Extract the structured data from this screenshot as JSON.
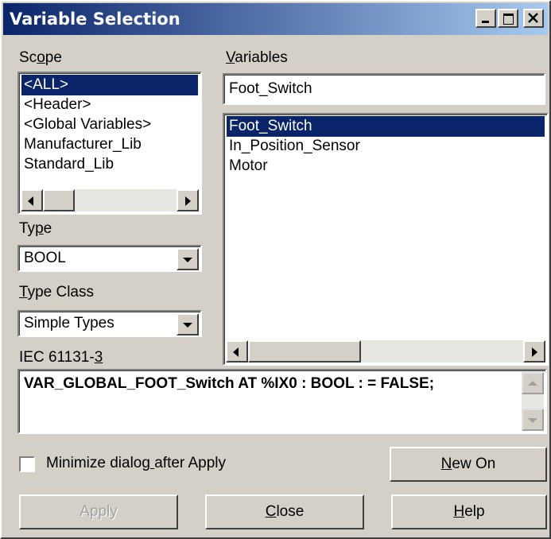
{
  "window": {
    "title": "Variable Selection"
  },
  "scope": {
    "label": "Scope",
    "items": [
      "<ALL>",
      "<Header>",
      "<Global Variables>",
      "Manufacturer_Lib",
      "Standard_Lib"
    ],
    "selected_index": 0
  },
  "type": {
    "label": "Type",
    "value": "BOOL"
  },
  "type_class": {
    "label": "Type Class",
    "value": "Simple Types"
  },
  "iec": {
    "label": "IEC 61131-3",
    "statement": "VAR_GLOBAL_FOOT_Switch AT %IX0 : BOOL : = FALSE;"
  },
  "variables": {
    "label": "Variables",
    "filter_value": "Foot_Switch",
    "items": [
      "Foot_Switch",
      "In_Position_Sensor",
      "Motor"
    ],
    "selected_index": 0
  },
  "minimize": {
    "label": "Minimize dialog after Apply",
    "checked": false
  },
  "buttons": {
    "new_on": "New On",
    "apply": "Apply",
    "close": "Close",
    "help": "Help"
  },
  "colors": {
    "titlebar": "#0a246a",
    "face": "#d4d0c8",
    "selection": "#0a246a"
  }
}
